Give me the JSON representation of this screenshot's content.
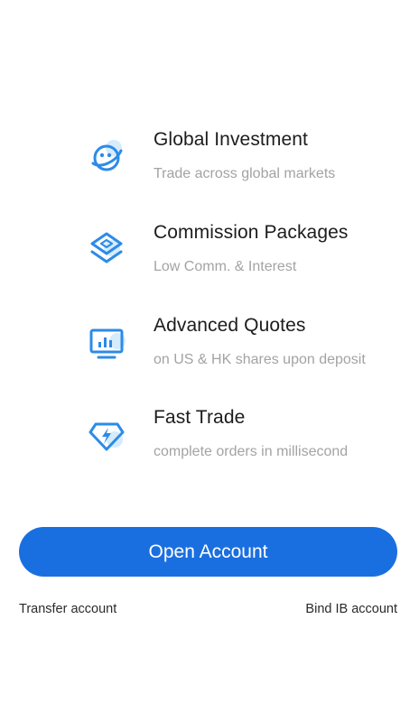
{
  "colors": {
    "accent": "#1a6fe0",
    "icon_blue": "#2c8be8",
    "icon_glow": "#d6ebfb",
    "title_text": "#1c1c1c",
    "desc_text": "#a3a3a3"
  },
  "features": [
    {
      "icon": "globe-planet-icon",
      "title": "Global Investment",
      "desc": "Trade across global markets"
    },
    {
      "icon": "layers-icon",
      "title": "Commission Packages",
      "desc": "Low Comm. & Interest"
    },
    {
      "icon": "monitor-chart-icon",
      "title": "Advanced Quotes",
      "desc": "on US & HK shares upon deposit"
    },
    {
      "icon": "diamond-lightning-icon",
      "title": "Fast Trade",
      "desc": "complete orders in millisecond"
    }
  ],
  "actions": {
    "open_account_label": "Open Account",
    "transfer_account_label": "Transfer account",
    "bind_ib_account_label": "Bind IB account"
  }
}
